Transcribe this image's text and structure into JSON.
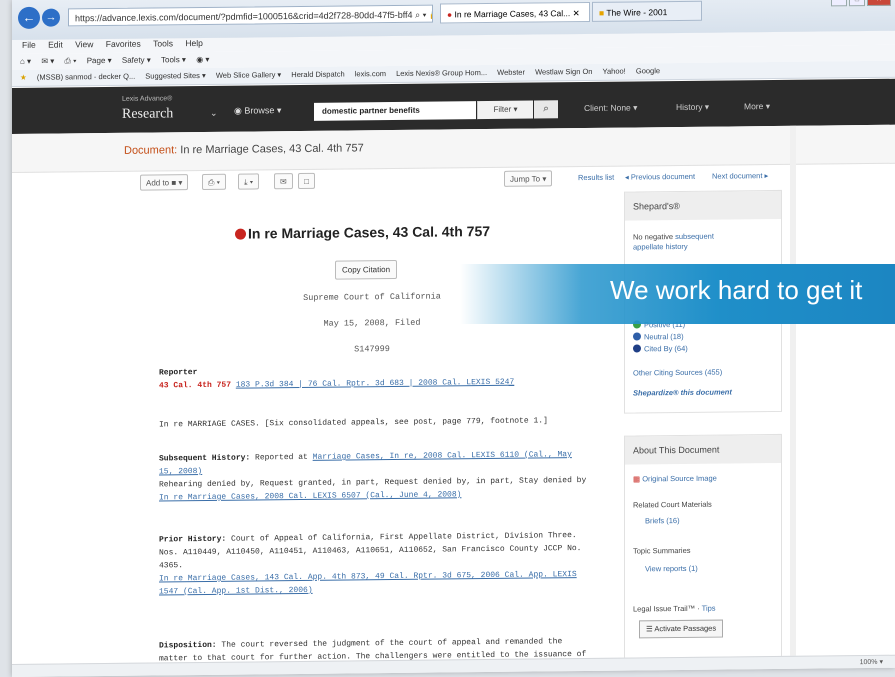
{
  "browser": {
    "back_icon": "back-arrow-icon",
    "forward_icon": "forward-arrow-icon",
    "address": "https://advance.lexis.com/document/?pdmfid=1000516&crid=4d2f728-80dd-47f5-bff4",
    "address_controls": "⌕ ▾ 🔒 C",
    "tabs": [
      "In re Marriage Cases, 43 Cal...",
      "The Wire - 2001"
    ],
    "window_controls": [
      "–",
      "□",
      "✕"
    ],
    "menu": [
      "File",
      "Edit",
      "View",
      "Favorites",
      "Tools",
      "Help"
    ],
    "commands": [
      "⌂ ▾",
      "✉ ▾",
      "⎙ ▾",
      "Page ▾",
      "Safety ▾",
      "Tools ▾",
      "◉ ▾"
    ],
    "favorites": [
      "(MSSB) sanmod - decker Q...",
      "Suggested Sites ▾",
      "Web Slice Gallery ▾",
      "Herald Dispatch",
      "lexis.com",
      "Lexis Nexis® Group Hom...",
      "Webster",
      "Westlaw Sign On",
      "Yahoo!",
      "Google"
    ]
  },
  "lexis": {
    "brand_small": "Lexis Advance®",
    "brand_big": "Research",
    "browse_label": "Browse ▾",
    "search_value": "domestic partner benefits",
    "filter_label": "Filter ▾",
    "search_icon": "⌕",
    "client_label": "Client: None ▾",
    "history_label": "History ▾",
    "more_label": "More ▾"
  },
  "document_strip": {
    "label": "Document:",
    "title": "In re Marriage Cases, 43 Cal. 4th 757"
  },
  "toolbar": {
    "add_to": "Add to ■ ▾",
    "print": "⎙ ▾",
    "download": "⤓ ▾",
    "email": "✉",
    "folder": "□",
    "jump_to": "Jump To ▾",
    "results_link": "Results list",
    "previous_link": "◂ Previous document",
    "next_link": "Next document ▸"
  },
  "document": {
    "title": "In re Marriage Cases, 43 Cal. 4th 757",
    "copy_citation": "Copy Citation",
    "court": "Supreme Court of California",
    "date": "May 15, 2008, Filed",
    "docket": "S147999",
    "reporter_label": "Reporter",
    "reporter_cite": "43 Cal. 4th 757",
    "parallel_cites": "183 P.3d 384 | 76 Cal. Rptr. 3d 683 | 2008 Cal. LEXIS 5247",
    "caption": "In re MARRIAGE CASES. [Six consolidated appeals, see post, page 779, footnote 1.]",
    "subsequent_label": "Subsequent History:",
    "subsequent_text": "Reported at",
    "subsequent_link": "Marriage Cases, In re, 2008 Cal. LEXIS 6110 (Cal., May 15, 2008)",
    "rehearing_text": "Rehearing denied by, Request granted, in part, Request denied by, in part, Stay denied by",
    "rehearing_link": "In re Marriage Cases, 2008 Cal. LEXIS 6507 (Cal., June 4, 2008)",
    "prior_label": "Prior History:",
    "prior_text": "Court of Appeal of California, First Appellate District, Division Three. Nos. A110449, A110450, A110451, A110463, A110651, A110652, San Francisco County JCCP No. 4365.",
    "prior_link": "In re Marriage Cases, 143 Cal. App. 4th 873, 49 Cal. Rptr. 3d 675, 2006 Cal. App. LEXIS 1547 (Cal. App. 1st Dist., 2006)",
    "disposition_label": "Disposition:",
    "disposition_text": "The court reversed the judgment of the court of appeal and remanded the matter to that court for further action. The challengers were entitled to the issuance of a"
  },
  "sidebar": {
    "shepards_head": "Shepard's®",
    "shepards_line1": "No negative",
    "shepards_link1": "subsequent",
    "shepards_link2": "appellate history",
    "positive": "Positive (11)",
    "neutral": "Neutral (18)",
    "cited_by": "Cited By (64)",
    "other_sources": "Other Citing Sources (455)",
    "shepardize": "Shepardize® this document",
    "about_head": "About This Document",
    "original_image": "Original Source Image",
    "related_label": "Related Court Materials",
    "briefs": "Briefs (16)",
    "topic_label": "Topic Summaries",
    "view_reports": "View reports (1)",
    "trail_label": "Legal Issue Trail™",
    "tips": "Tips",
    "activate": "Activate Passages"
  },
  "banner": {
    "text": "We work hard to get it"
  },
  "status": {
    "zoom": "100% ▾"
  },
  "colors": {
    "accent_blue": "#1f8fc9",
    "lexis_bar": "#2b2b2b",
    "doc_orange": "#c4501a",
    "red_flag": "#c8251f",
    "link": "#3a6ea8"
  }
}
